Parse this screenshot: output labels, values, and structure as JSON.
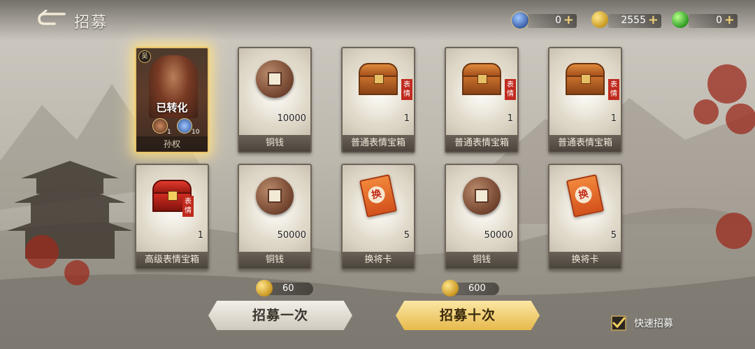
{
  "header": {
    "title": "招募"
  },
  "resources": [
    {
      "icon": "jade-token-icon",
      "value": "0"
    },
    {
      "icon": "gold-coin-icon",
      "value": "2555"
    },
    {
      "icon": "green-gem-icon",
      "value": "0"
    }
  ],
  "hero": {
    "status": "已转化",
    "name": "孙权",
    "faction": "吴",
    "item1_count": "1",
    "item2_count": "10"
  },
  "cards": [
    {
      "name": "铜钱",
      "qty": "10000",
      "icon": "copper-coin-icon"
    },
    {
      "name": "普通表情宝箱",
      "qty": "1",
      "icon": "treasure-chest-icon",
      "tag": "表情"
    },
    {
      "name": "普通表情宝箱",
      "qty": "1",
      "icon": "treasure-chest-icon",
      "tag": "表情"
    },
    {
      "name": "普通表情宝箱",
      "qty": "1",
      "icon": "treasure-chest-icon",
      "tag": "表情"
    },
    {
      "name": "高级表情宝箱",
      "qty": "1",
      "icon": "red-treasure-chest-icon",
      "tag": "表情"
    },
    {
      "name": "铜钱",
      "qty": "50000",
      "icon": "copper-coin-icon"
    },
    {
      "name": "换将卡",
      "qty": "5",
      "icon": "swap-general-card-icon",
      "seal": "换"
    },
    {
      "name": "铜钱",
      "qty": "50000",
      "icon": "copper-coin-icon"
    },
    {
      "name": "换将卡",
      "qty": "5",
      "icon": "swap-general-card-icon",
      "seal": "换"
    }
  ],
  "costs": {
    "once": "60",
    "ten": "600"
  },
  "buttons": {
    "once": "招募一次",
    "ten": "招募十次"
  },
  "quick": {
    "label": "快速招募",
    "checked": true
  }
}
